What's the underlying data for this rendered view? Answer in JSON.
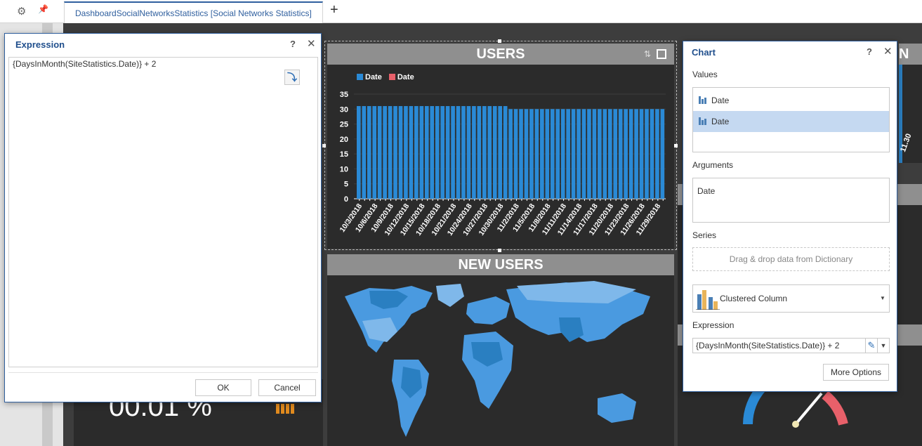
{
  "toolbar": {
    "gear_icon": "gear-icon",
    "pin_icon": "pin-icon"
  },
  "tabs": [
    {
      "label": "DashboardSocialNetworksStatistics [Social Networks Statistics]"
    }
  ],
  "add_tab": "+",
  "dashboard": {
    "users_title": "USERS",
    "new_users_title": "NEW USERS",
    "right_title_fragment": "N",
    "right_tick_fragment": "11.30",
    "big_value": "00.01 %"
  },
  "chart_data": {
    "type": "bar",
    "title": "USERS",
    "legend": [
      "Date",
      "Date"
    ],
    "legend_colors": [
      "#2a8ad6",
      "#e8606a"
    ],
    "ylim": [
      0,
      35
    ],
    "yticks": [
      0,
      5,
      10,
      15,
      20,
      25,
      30,
      35
    ],
    "categories": [
      "10/3/2018",
      "10/4/2018",
      "10/5/2018",
      "10/6/2018",
      "10/7/2018",
      "10/8/2018",
      "10/9/2018",
      "10/10/2018",
      "10/11/2018",
      "10/12/2018",
      "10/13/2018",
      "10/14/2018",
      "10/15/2018",
      "10/16/2018",
      "10/17/2018",
      "10/18/2018",
      "10/19/2018",
      "10/20/2018",
      "10/21/2018",
      "10/22/2018",
      "10/23/2018",
      "10/24/2018",
      "10/25/2018",
      "10/26/2018",
      "10/27/2018",
      "10/28/2018",
      "10/29/2018",
      "10/30/2018",
      "10/31/2018",
      "11/1/2018",
      "11/2/2018",
      "11/3/2018",
      "11/4/2018",
      "11/5/2018",
      "11/6/2018",
      "11/7/2018",
      "11/8/2018",
      "11/9/2018",
      "11/10/2018",
      "11/11/2018",
      "11/12/2018",
      "11/13/2018",
      "11/14/2018",
      "11/15/2018",
      "11/16/2018",
      "11/17/2018",
      "11/18/2018",
      "11/19/2018",
      "11/20/2018",
      "11/21/2018",
      "11/22/2018",
      "11/23/2018",
      "11/24/2018",
      "11/25/2018",
      "11/26/2018",
      "11/27/2018",
      "11/28/2018",
      "11/29/2018",
      "11/30/2018"
    ],
    "tick_labels": [
      "10/3/2018",
      "10/6/2018",
      "10/9/2018",
      "10/12/2018",
      "10/15/2018",
      "10/18/2018",
      "10/21/2018",
      "10/24/2018",
      "10/27/2018",
      "10/30/2018",
      "11/2/2018",
      "11/5/2018",
      "11/8/2018",
      "11/11/2018",
      "11/14/2018",
      "11/17/2018",
      "11/20/2018",
      "11/23/2018",
      "11/26/2018",
      "11/29/2018"
    ],
    "values": [
      31,
      31,
      31,
      31,
      31,
      31,
      31,
      31,
      31,
      31,
      31,
      31,
      31,
      31,
      31,
      31,
      31,
      31,
      31,
      31,
      31,
      31,
      31,
      31,
      31,
      31,
      31,
      31,
      31,
      30,
      30,
      30,
      30,
      30,
      30,
      30,
      30,
      30,
      30,
      30,
      30,
      30,
      30,
      30,
      30,
      30,
      30,
      30,
      30,
      30,
      30,
      30,
      30,
      30,
      30,
      30,
      30,
      30,
      30
    ],
    "bar_color": "#2a8ad6"
  },
  "expression_dialog": {
    "title": "Expression",
    "help": "?",
    "close": "✕",
    "text": "{DaysInMonth(SiteStatistics.Date)}  + 2",
    "ok": "OK",
    "cancel": "Cancel"
  },
  "chart_dialog": {
    "title": "Chart",
    "help": "?",
    "close": "✕",
    "values_label": "Values",
    "values": [
      "Date",
      "Date"
    ],
    "arguments_label": "Arguments",
    "arguments": [
      "Date"
    ],
    "series_label": "Series",
    "series_placeholder": "Drag & drop data from Dictionary",
    "chart_type": "Clustered Column",
    "expression_label": "Expression",
    "expression_value": "{DaysInMonth(SiteStatistics.Date)}  + 2",
    "more_options": "More Options"
  }
}
